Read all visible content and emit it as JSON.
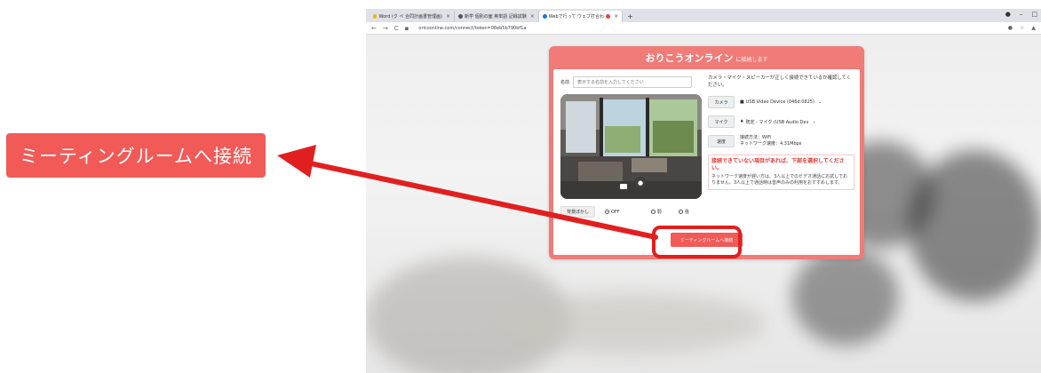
{
  "callout": {
    "label": "ミーティングルームへ接続"
  },
  "browser": {
    "tabs": [
      {
        "label": "Word (ク ペ 合同計画書管理画)",
        "close": "×"
      },
      {
        "label": "新学 個別の面 英単語 記録試験",
        "close": "×"
      },
      {
        "label": "Webで行って ウェブ打合わ",
        "close": "×"
      }
    ],
    "new_tab": "+",
    "url": "oricoonline.com/connect/token=08eb5b790bf1a",
    "window_controls": [
      "●",
      "–",
      "□"
    ]
  },
  "modal": {
    "title": "おりこうオンライン",
    "subtitle": "に接続します",
    "name_label": "名前",
    "name_placeholder": "表示する名前を入力してください",
    "hint": "カメラ・マイク・スピーカーが正しく接続できているか確認してください。",
    "camera_label": "カメラ",
    "camera_value": "USB Video Device (046d:0825)",
    "mic_label": "マイク",
    "mic_value": "既定 - マイク (USB Audio Dev",
    "speed_label": "速度",
    "speed_value_1": "接続方法：WiFi",
    "speed_value_2": "ネットワーク速度：4.31Mbps",
    "warn_title": "接続できていない項目があれば、下部を選択してください。",
    "warn_text": "ネットワーク速度が遅い方は、3人以上でのビデオ通話にお試しでおりません。3人以上で通話時は音声のみの利用をおすすめします。",
    "bg_button": "背景ぼかし",
    "radio_options": [
      "OFF",
      "弱",
      "強"
    ],
    "connect_button": "ミーティングルームへ接続"
  },
  "colors": {
    "accent": "#f15a57",
    "modal_header": "#f07b77",
    "highlight": "#e21f1f"
  }
}
